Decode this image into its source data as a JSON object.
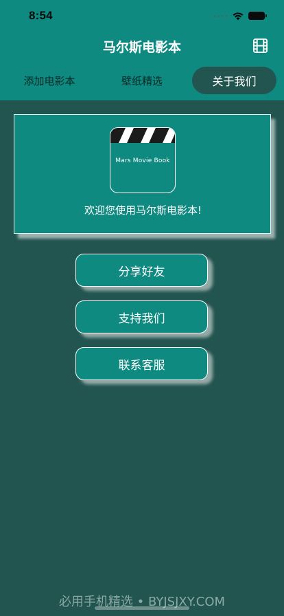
{
  "status_bar": {
    "time": "8:54",
    "icons": [
      "cellular-dots-icon",
      "wifi-icon",
      "battery-icon"
    ]
  },
  "header": {
    "title": "马尔斯电影本",
    "right_icon": "film-icon"
  },
  "tabs": [
    {
      "label": "添加电影本",
      "selected": false
    },
    {
      "label": "壁纸精选",
      "selected": false
    },
    {
      "label": "关于我们",
      "selected": true
    }
  ],
  "welcome_card": {
    "logo_text": "Mars Movie Book",
    "logo_icon": "clapperboard-icon",
    "message": "欢迎您使用马尔斯电影本!"
  },
  "buttons": {
    "share": "分享好友",
    "support": "支持我们",
    "contact": "联系客服"
  },
  "footer": {
    "watermark": "必用手机精选 • BYJSJXY.COM"
  },
  "colors": {
    "header_bg": "#0e8a80",
    "page_bg": "#225450",
    "selected_tab_bg": "#225450",
    "text_light": "#ffffff"
  }
}
